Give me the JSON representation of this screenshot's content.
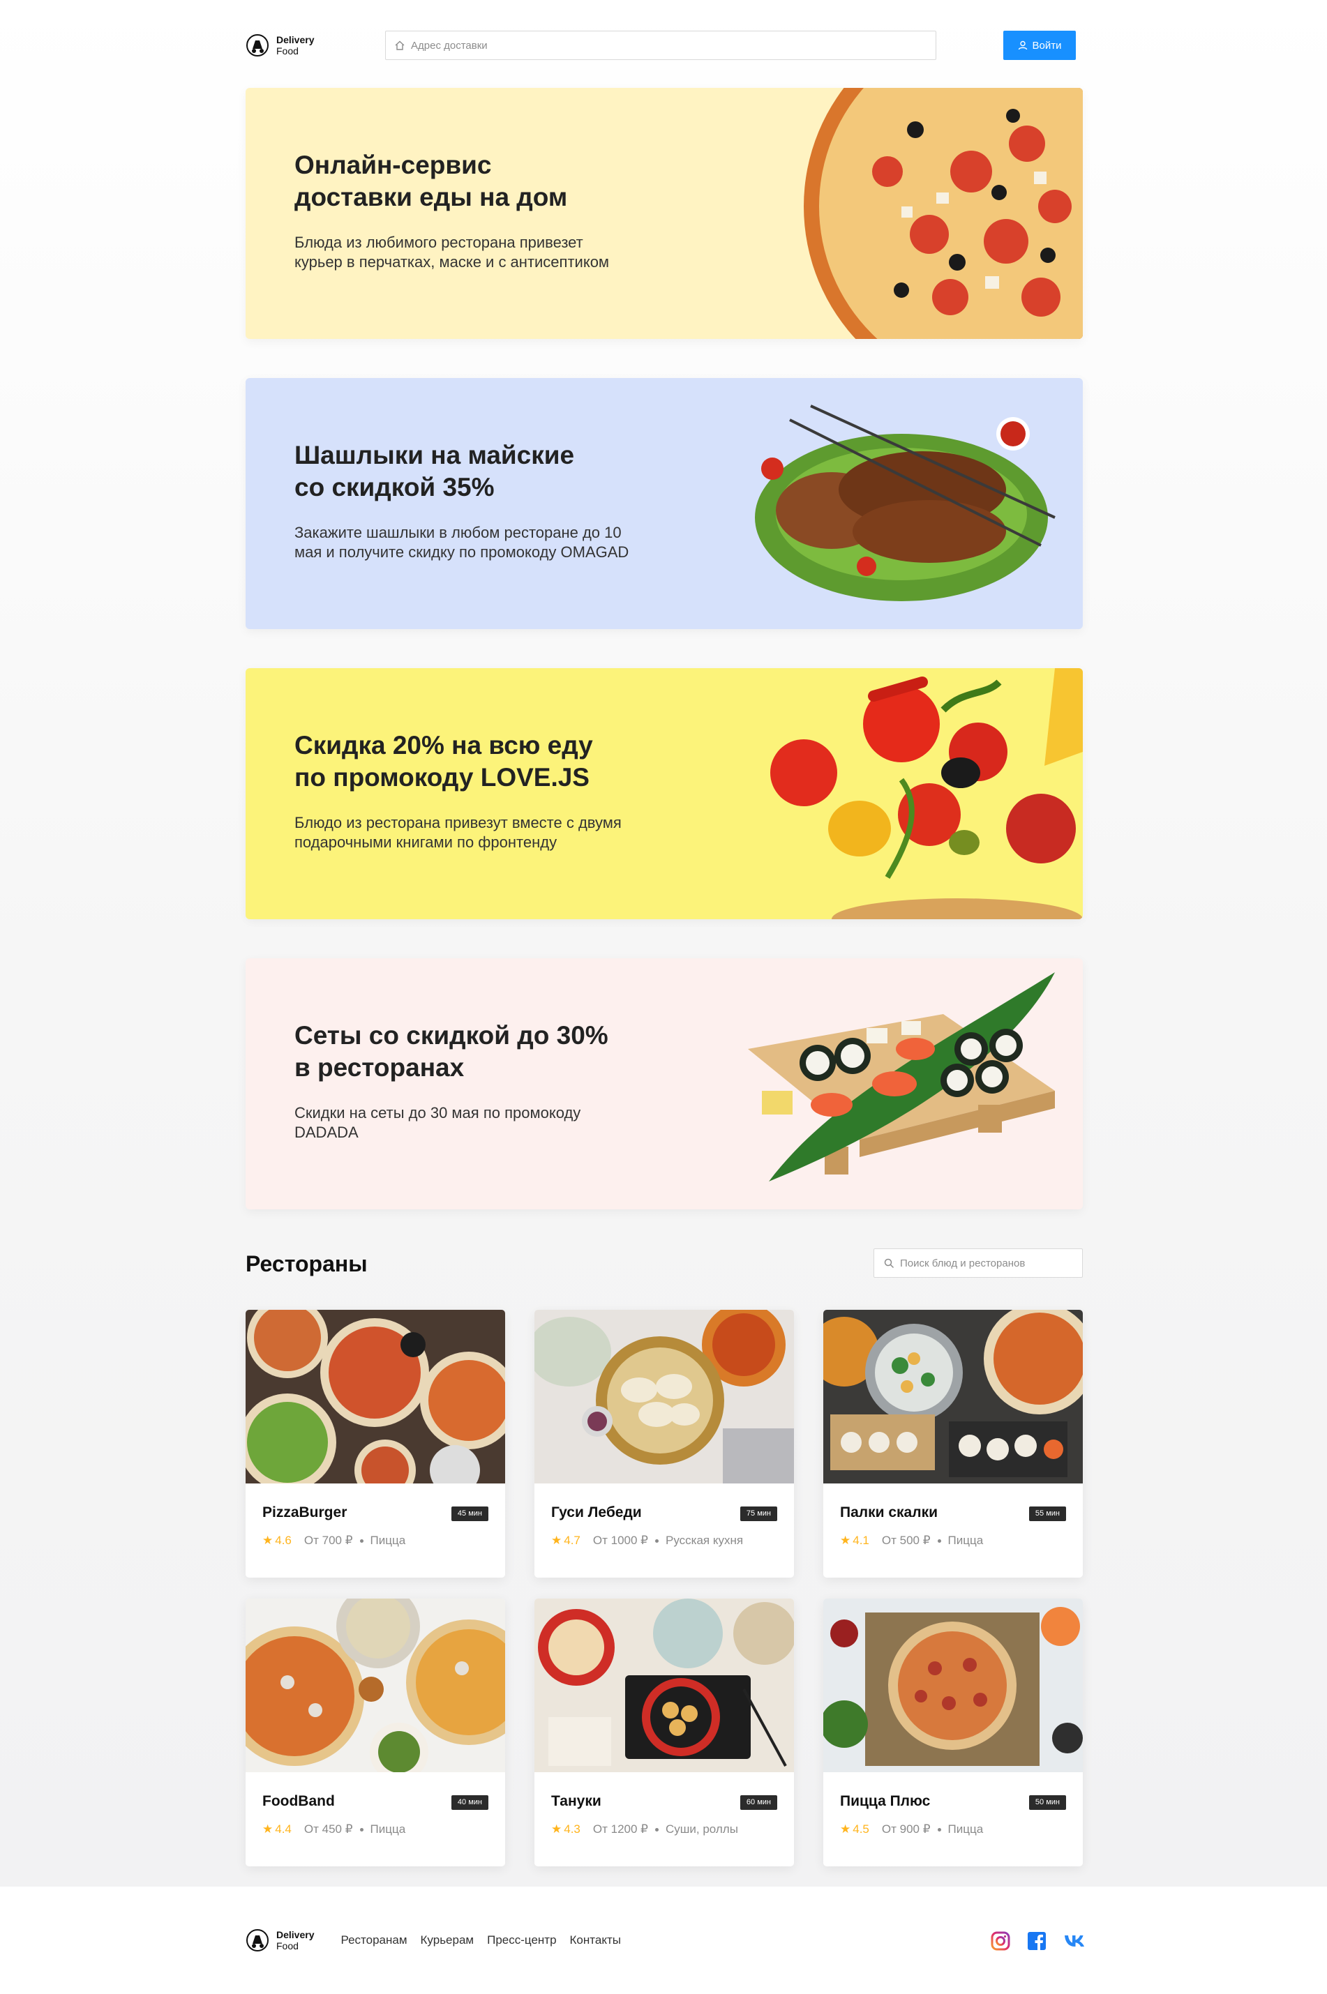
{
  "header": {
    "logo_line1": "Delivery",
    "logo_line2": "Food",
    "address_placeholder": "Адрес доставки",
    "login_label": "Войти"
  },
  "promos": [
    {
      "title": "Онлайн-сервис\nдоставки еды на дом",
      "desc": "Блюда из любимого ресторана привезет\nкурьер в перчатках, маске и с антисептиком",
      "bg": "#fff3c2",
      "image": "pizza"
    },
    {
      "title": "Шашлыки на майские\nсо скидкой 35%",
      "desc": "Закажите шашлыки в любом ресторане до 10\nмая и получите скидку по промокоду OMAGAD",
      "bg": "#d6e1fb",
      "image": "shashlik"
    },
    {
      "title": "Скидка 20% на всю еду\nпо промокоду LOVE.JS",
      "desc": "Блюдо из ресторана привезут вместе с двумя\nподарочными книгами по фронтенду",
      "bg": "#fcf37a",
      "image": "flying-vegetables"
    },
    {
      "title": "Сеты со скидкой до 30%\nв ресторанах",
      "desc": "Скидки на сеты до 30 мая по промокоду\nDADADA",
      "bg": "#fdf0ee",
      "image": "sushi-set"
    }
  ],
  "restaurants_section": {
    "title": "Рестораны",
    "search_placeholder": "Поиск блюд и ресторанов"
  },
  "restaurants": [
    {
      "name": "PizzaBurger",
      "time": "45 мин",
      "rating": "4.6",
      "price": "От 700 ₽",
      "category": "Пицца",
      "image": "pizzas-table"
    },
    {
      "name": "Гуси Лебеди",
      "time": "75 мин",
      "rating": "4.7",
      "price": "От 1000 ₽",
      "category": "Русская кухня",
      "image": "dumplings"
    },
    {
      "name": "Палки скалки",
      "time": "55 мин",
      "rating": "4.1",
      "price": "От 500 ₽",
      "category": "Пицца",
      "image": "sushi-pizza"
    },
    {
      "name": "FoodBand",
      "time": "40 мин",
      "rating": "4.4",
      "price": "От 450 ₽",
      "category": "Пицца",
      "image": "pizza-slices"
    },
    {
      "name": "Тануки",
      "time": "60 мин",
      "rating": "4.3",
      "price": "От 1200 ₽",
      "category": "Суши, роллы",
      "image": "asian-bowls"
    },
    {
      "name": "Пицца Плюс",
      "time": "50 мин",
      "rating": "4.5",
      "price": "От 900 ₽",
      "category": "Пицца",
      "image": "pizza-board"
    }
  ],
  "footer": {
    "logo_line1": "Delivery",
    "logo_line2": "Food",
    "links": [
      "Ресторанам",
      "Курьерам",
      "Пресс-центр",
      "Контакты"
    ],
    "social": [
      "instagram-icon",
      "facebook-icon",
      "vk-icon"
    ]
  },
  "colors": {
    "accent": "#1890ff",
    "rating": "#ffb41d",
    "time_badge": "#2b2b2b"
  }
}
